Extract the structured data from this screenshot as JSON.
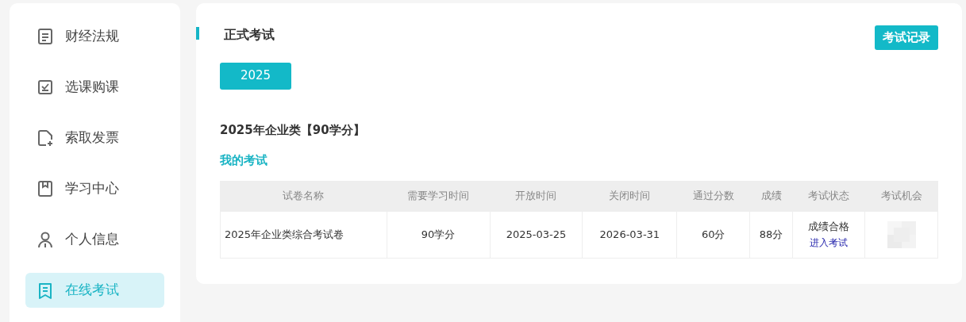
{
  "sidebar": {
    "items": [
      {
        "label": "财经法规",
        "kind": "document",
        "selected": false
      },
      {
        "label": "选课购课",
        "kind": "checkbox",
        "selected": false
      },
      {
        "label": "索取发票",
        "kind": "file",
        "selected": false
      },
      {
        "label": "学习中心",
        "kind": "bookmark",
        "selected": false
      },
      {
        "label": "个人信息",
        "kind": "person",
        "selected": false
      },
      {
        "label": "在线考试",
        "kind": "exam",
        "selected": true
      }
    ]
  },
  "main": {
    "title": "正式考试",
    "record_button": "考试记录",
    "year_tabs": [
      {
        "label": "2025",
        "selected": true
      }
    ],
    "course_title": "2025年企业类【90学分】",
    "section_title": "我的考试",
    "table": {
      "columns": [
        "试卷名称",
        "需要学习时间",
        "开放时间",
        "关闭时间",
        "通过分数",
        "成绩",
        "考试状态",
        "考试机会"
      ],
      "rows": [
        {
          "name": "2025年企业类综合考试卷",
          "study_time": "90学分",
          "open_time": "2025-03-25",
          "close_time": "2026-03-31",
          "pass_score": "60分",
          "score": "88分",
          "status": "成绩合格",
          "action_link": "进入考试"
        }
      ]
    }
  }
}
